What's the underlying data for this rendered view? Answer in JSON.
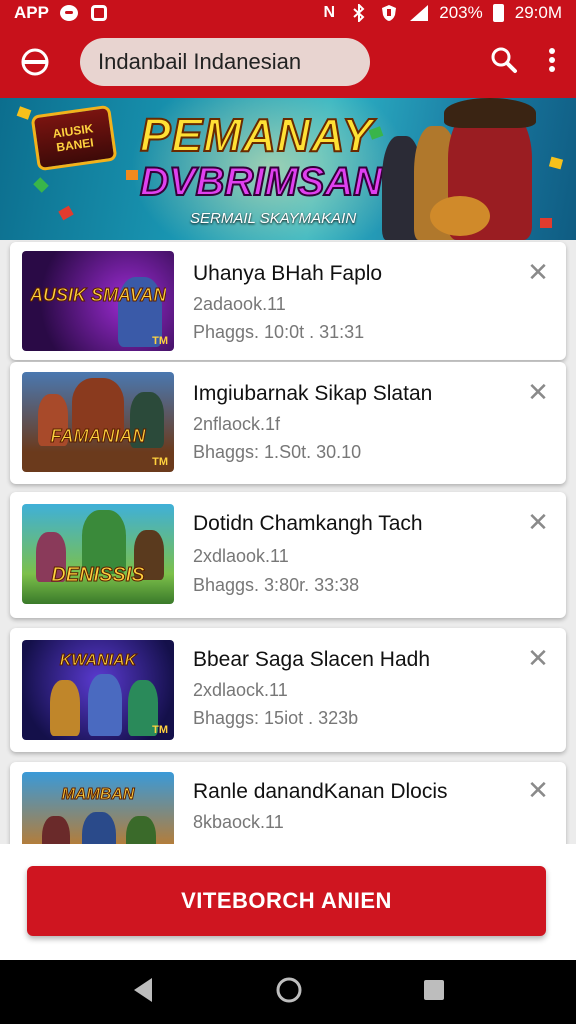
{
  "status_bar": {
    "app_label": "APP",
    "battery_percent": "203%",
    "time": "29:0M"
  },
  "app_bar": {
    "search_text": "Indanbail Indanesian",
    "icons": [
      "circle-logo-icon",
      "search-icon",
      "more-vert-icon"
    ]
  },
  "banner": {
    "badge_line1": "AIUSIK",
    "badge_line2": "BANEI",
    "title_line1": "PEMANAY",
    "title_line2": "DVBRIMSAN",
    "subtitle": "SERMAIL SKAYMAKAIN"
  },
  "list": {
    "items": [
      {
        "title": "Uhanya BHah Faplo",
        "meta1": "2adaook.11",
        "meta2": "Phaggs. 10:0t . 31:31",
        "thumb_label": "AUSIK SMAVAN",
        "thumb_badge": "TM"
      },
      {
        "title": "Imgiubarnak Sikap Slatan",
        "meta1": "2nflaock.1f",
        "meta2": "Bhaggs: 1.S0t. 30.10",
        "thumb_label": "FAMANIAN",
        "thumb_badge": "TM"
      },
      {
        "title": "Dotidn Chamkangh Tach",
        "meta1": "2xdlaook.11",
        "meta2": "Bhaggs. 3:80r. 33:38",
        "thumb_label": "DENISSIS",
        "thumb_badge": ""
      },
      {
        "title": "Bbear Saga Slacen Hadh",
        "meta1": "2xdlaock.11",
        "meta2": "Bhaggs: 15iot . 323b",
        "thumb_label": "KWANIAK",
        "thumb_badge": "TM"
      },
      {
        "title": "Ranle danandKanan Dlocis",
        "meta1": "8kbaock.11",
        "meta2": "",
        "thumb_label": "MAMBAN",
        "thumb_badge": ""
      }
    ]
  },
  "cta": {
    "label": "VITEBORCH ANIEN"
  },
  "colors": {
    "primary_red": "#c8111b",
    "button_red": "#cf1520",
    "search_pill": "#e8d4d0"
  }
}
